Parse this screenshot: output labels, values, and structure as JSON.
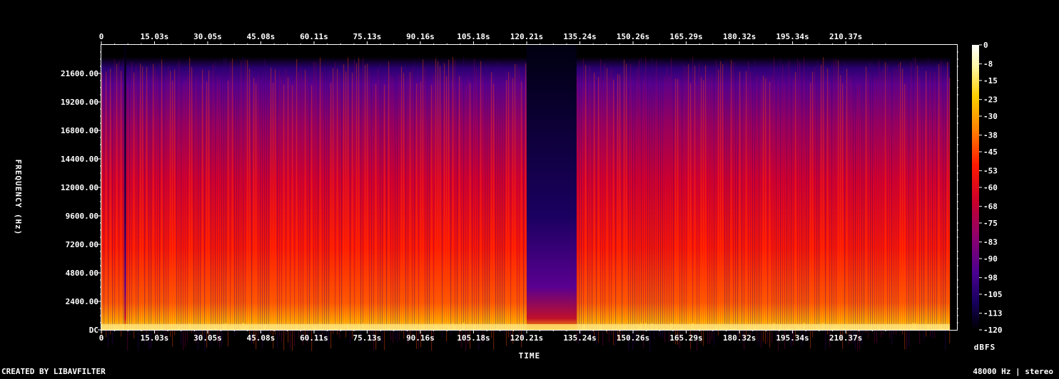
{
  "chart_data": {
    "type": "heatmap",
    "xlabel": "TIME",
    "ylabel": "FREQUENCY (Hz)",
    "x_ticks": [
      "0",
      "15.03s",
      "30.05s",
      "45.08s",
      "60.11s",
      "75.13s",
      "90.16s",
      "105.18s",
      "120.21s",
      "135.24s",
      "150.26s",
      "165.29s",
      "180.32s",
      "195.34s",
      "210.37s"
    ],
    "x_tick_values": [
      0,
      15.03,
      30.05,
      45.08,
      60.11,
      75.13,
      90.16,
      105.18,
      120.21,
      135.24,
      150.26,
      165.29,
      180.32,
      195.34,
      210.37
    ],
    "xlim": [
      0,
      241.8
    ],
    "y_ticks": [
      "DC",
      "2400.00",
      "4800.00",
      "7200.00",
      "9600.00",
      "12000.00",
      "14400.00",
      "16800.00",
      "19200.00",
      "21600.00"
    ],
    "y_tick_values": [
      0,
      2400,
      4800,
      7200,
      9600,
      12000,
      14400,
      16800,
      19200,
      21600
    ],
    "ylim": [
      0,
      24000
    ],
    "colorbar": {
      "label": "dBFS",
      "ticks": [
        "0",
        "-8",
        "-15",
        "-23",
        "-30",
        "-38",
        "-45",
        "-53",
        "-60",
        "-68",
        "-75",
        "-83",
        "-90",
        "-98",
        "-105",
        "-113",
        "-120"
      ],
      "tick_values": [
        0,
        -8,
        -15,
        -23,
        -30,
        -38,
        -45,
        -53,
        -60,
        -68,
        -75,
        -83,
        -90,
        -98,
        -105,
        -113,
        -120
      ],
      "range": [
        -120,
        0
      ]
    },
    "quiet_intervals_s": [
      [
        6.5,
        7.0
      ],
      [
        120.2,
        134.3
      ]
    ],
    "end_time_s": 239.8
  },
  "footer": {
    "left": "CREATED BY LIBAVFILTER",
    "right": "48000 Hz | stereo"
  }
}
